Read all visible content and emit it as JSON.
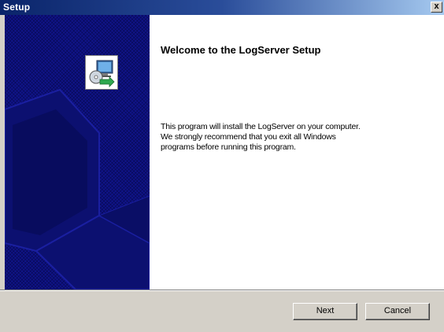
{
  "window": {
    "title": "Setup",
    "close_glyph": "x"
  },
  "side_panel": {
    "app_icon": "installer-computer-icon"
  },
  "content": {
    "heading": "Welcome to the LogServer Setup",
    "body": "This program will install the LogServer on your computer.\nWe strongly recommend that you exit all Windows\nprograms before running this program."
  },
  "buttons": {
    "next": "Next",
    "cancel": "Cancel"
  },
  "colors": {
    "title_bar": "#0a246a",
    "side_panel": "#10148a",
    "dialog_face": "#d4d0c8"
  }
}
